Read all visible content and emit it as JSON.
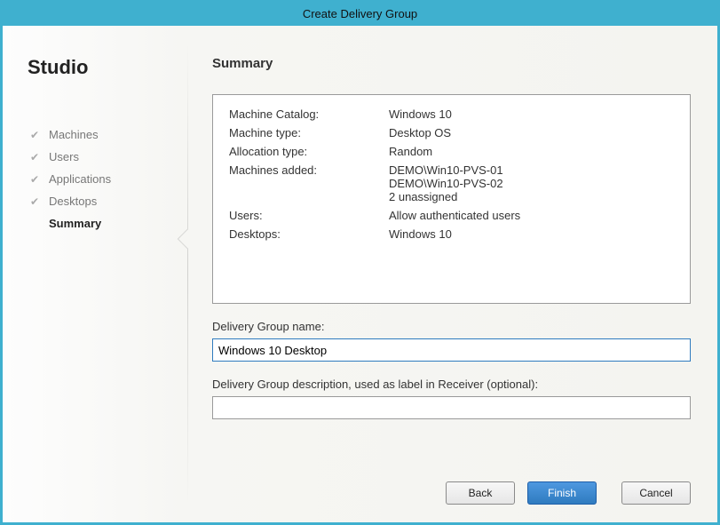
{
  "window": {
    "title": "Create Delivery Group"
  },
  "sidebar": {
    "heading": "Studio",
    "steps": [
      {
        "label": "Machines",
        "done": true
      },
      {
        "label": "Users",
        "done": true
      },
      {
        "label": "Applications",
        "done": true
      },
      {
        "label": "Desktops",
        "done": true
      },
      {
        "label": "Summary",
        "current": true
      }
    ]
  },
  "main": {
    "heading": "Summary",
    "summary": [
      {
        "label": "Machine Catalog:",
        "values": [
          "Windows 10"
        ]
      },
      {
        "label": "Machine type:",
        "values": [
          "Desktop OS"
        ]
      },
      {
        "label": "Allocation type:",
        "values": [
          "Random"
        ]
      },
      {
        "label": "Machines added:",
        "values": [
          "DEMO\\Win10-PVS-01",
          "DEMO\\Win10-PVS-02",
          "2 unassigned"
        ]
      },
      {
        "label": "Users:",
        "values": [
          "Allow authenticated users"
        ]
      },
      {
        "label": "Desktops:",
        "values": [
          "Windows 10"
        ]
      }
    ],
    "name_label": "Delivery Group name:",
    "name_value": "Windows 10 Desktop",
    "desc_label": "Delivery Group description, used as label in Receiver (optional):",
    "desc_value": ""
  },
  "buttons": {
    "back": "Back",
    "finish": "Finish",
    "cancel": "Cancel"
  }
}
